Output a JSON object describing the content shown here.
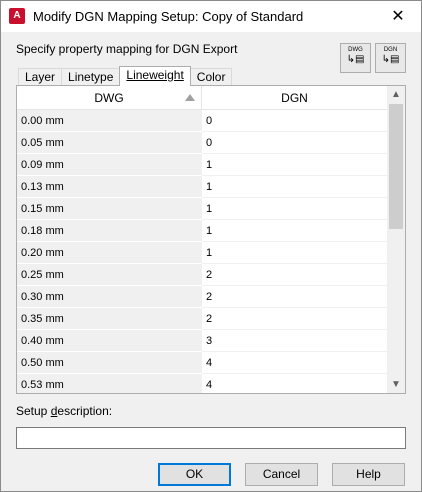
{
  "window": {
    "title": "Modify DGN Mapping Setup: Copy of Standard",
    "app_icon_letter": "A",
    "close_glyph": "✕"
  },
  "prompt": "Specify property mapping for DGN Export",
  "toolbar": {
    "dwg_to_dgn": {
      "label": "DWG",
      "glyph": "↳▤"
    },
    "dgn_to_dwg": {
      "label": "DGN",
      "glyph": "↳▤"
    }
  },
  "tabs": [
    {
      "label": "Layer",
      "active": false
    },
    {
      "label": "Linetype",
      "active": false
    },
    {
      "label": "Lineweight",
      "active": true
    },
    {
      "label": "Color",
      "active": false
    }
  ],
  "table": {
    "columns": [
      "DWG",
      "DGN"
    ],
    "rows": [
      [
        "0.00 mm",
        "0"
      ],
      [
        "0.05 mm",
        "0"
      ],
      [
        "0.09 mm",
        "1"
      ],
      [
        "0.13 mm",
        "1"
      ],
      [
        "0.15 mm",
        "1"
      ],
      [
        "0.18 mm",
        "1"
      ],
      [
        "0.20 mm",
        "1"
      ],
      [
        "0.25 mm",
        "2"
      ],
      [
        "0.30 mm",
        "2"
      ],
      [
        "0.35 mm",
        "2"
      ],
      [
        "0.40 mm",
        "3"
      ],
      [
        "0.50 mm",
        "4"
      ],
      [
        "0.53 mm",
        "4"
      ]
    ]
  },
  "description": {
    "label_pre": "Setup ",
    "label_underlined": "d",
    "label_post": "escription:",
    "value": ""
  },
  "buttons": {
    "ok": "OK",
    "cancel": "Cancel",
    "help": "Help"
  }
}
